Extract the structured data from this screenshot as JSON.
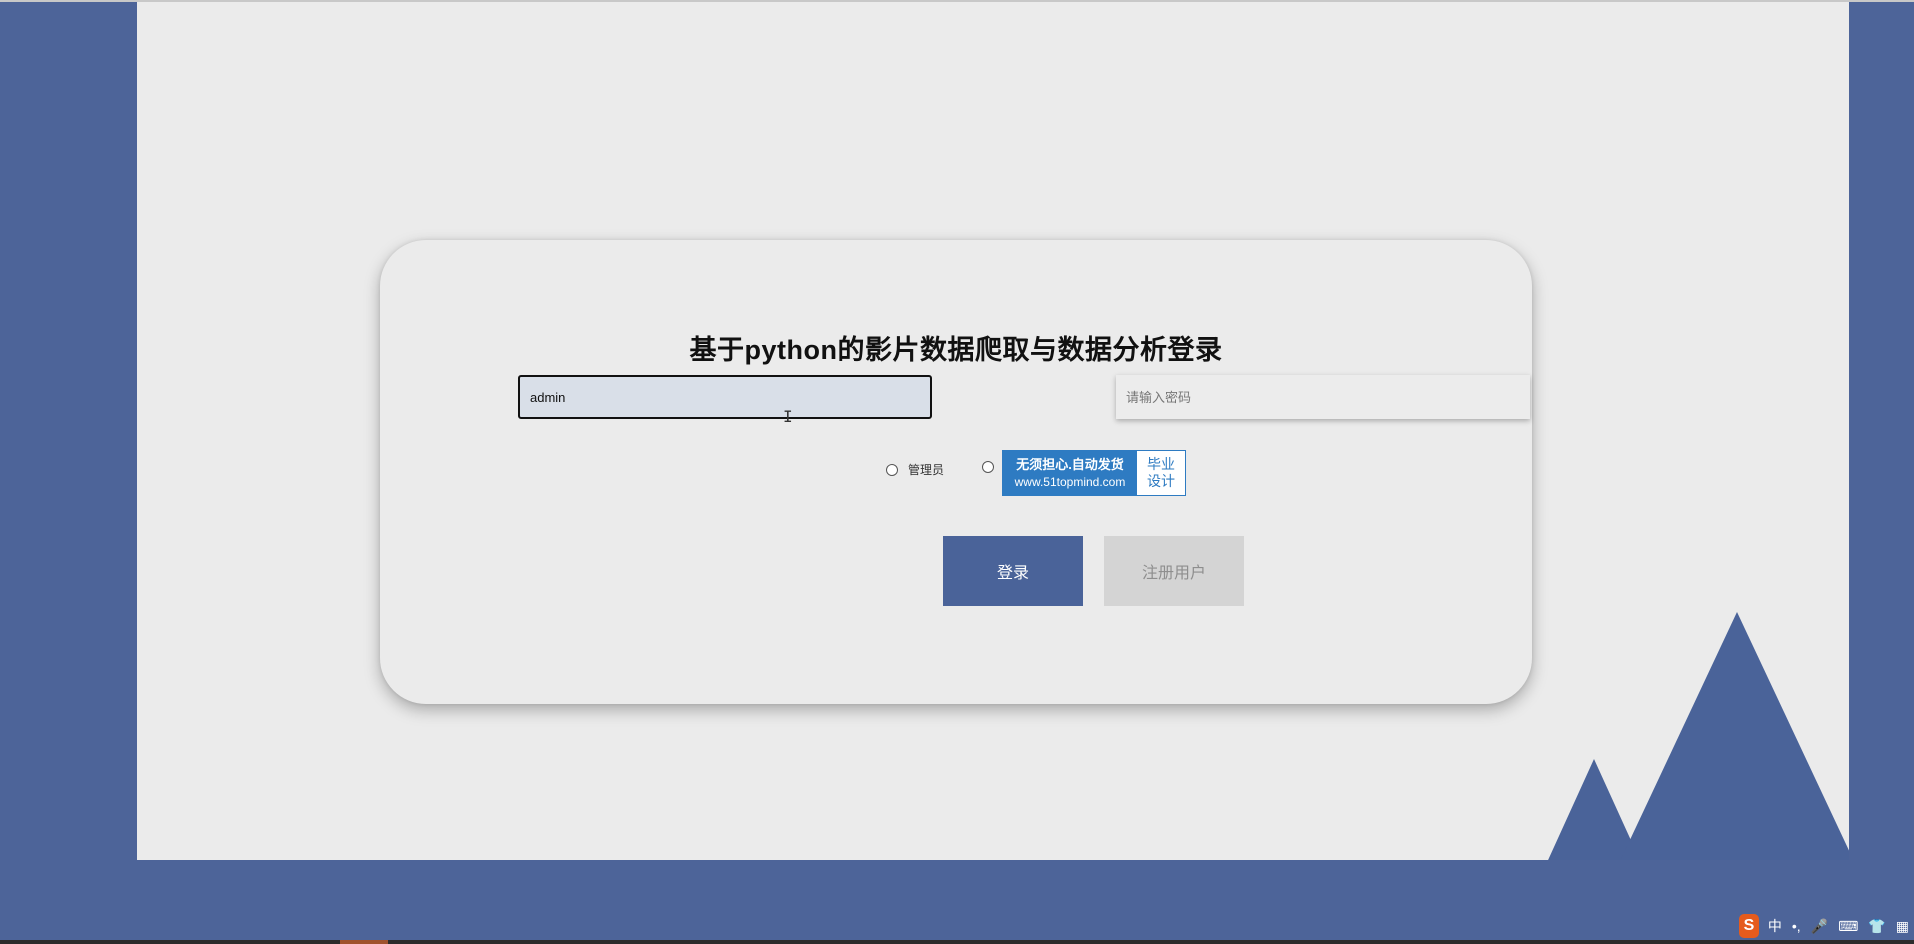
{
  "login": {
    "title": "基于python的影片数据爬取与数据分析登录",
    "username_value": "admin",
    "password_placeholder": "请输入密码",
    "roles": [
      "管理员",
      ""
    ],
    "login_button": "登录",
    "register_button": "注册用户"
  },
  "ad_badge": {
    "line1": "无须担心.自动发货",
    "line2": "www.51topmind.com",
    "side_line1": "毕业",
    "side_line2": "设计"
  },
  "ime_toolbar": {
    "logo": "S",
    "mode": "中",
    "punct": "•,",
    "mic": "🎤",
    "keyboard": "⌨",
    "skin": "👕",
    "grid": "▦"
  },
  "colors": {
    "brand_blue": "#4a6399",
    "page_bg": "#ebebeb",
    "register_disabled_bg": "#d4d4d4",
    "ad_blue": "#2e7bc2",
    "ime_orange": "#e55b1d"
  }
}
